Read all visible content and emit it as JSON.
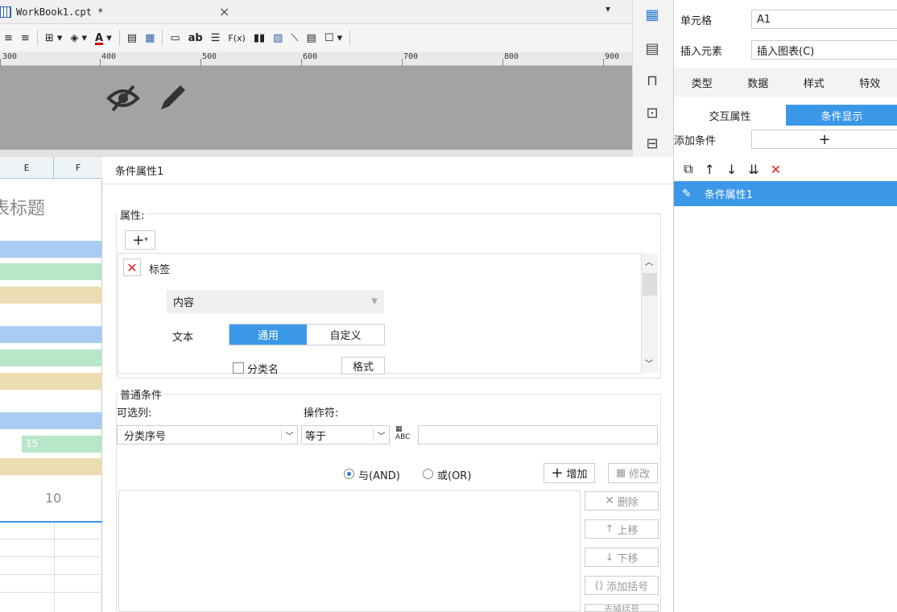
{
  "tab": {
    "title": "WorkBook1.cpt *",
    "close": "×"
  },
  "toolbar": {
    "items": [
      "≡",
      "≡",
      "⊞ ▾",
      "◈ ▾",
      "A ▾",
      "▦",
      "▦",
      "▭",
      "ab",
      "☰",
      "F(x)",
      "▮▮",
      "▨",
      "⟍",
      "▤",
      "☐ ▾"
    ]
  },
  "ruler": {
    "labels": [
      "300",
      "400",
      "500",
      "600",
      "700",
      "800",
      "900"
    ]
  },
  "canvas": {
    "icons": [
      "eye-off-icon",
      "pencil-icon"
    ]
  },
  "toolcol": {
    "icons": [
      "▦",
      "▤",
      "⊓",
      "⊡",
      "⊟"
    ]
  },
  "right_panel": {
    "cell_label": "单元格",
    "cell_value": "A1",
    "insert_label": "插入元素",
    "insert_value": "插入图表(C)",
    "tabs": [
      "类型",
      "数据",
      "样式",
      "特效"
    ],
    "subtabs": [
      "交互属性",
      "条件显示"
    ],
    "add_condition": "添加条件",
    "add_symbol": "+",
    "item": "条件属性1"
  },
  "sheet": {
    "col_e": "E",
    "col_f": "F",
    "title": "表标题",
    "num15": "15",
    "num10": "10",
    "colors": {
      "blue": "#a9cdf2",
      "green": "#b8e6c8",
      "tan": "#ecdcb4"
    }
  },
  "dialog": {
    "title": "条件属性1",
    "attr_group": "属性:",
    "add_btn": "+",
    "label_item": "标签",
    "content_label": "内容",
    "text_label": "文本",
    "seg_general": "通用",
    "seg_custom": "自定义",
    "category_name": "分类名",
    "format_btn": "格式",
    "cond_group": "普通条件",
    "optional_col": "可选列:",
    "operator": "操作符:",
    "col_value": "分类序号",
    "op_value": "等于",
    "and_label": "与(AND)",
    "or_label": "或(OR)",
    "add": "增加",
    "modify": "修改",
    "delete": "删除",
    "up": "上移",
    "down": "下移",
    "add_paren": "添加括号",
    "remove_paren": "去掉括号"
  }
}
